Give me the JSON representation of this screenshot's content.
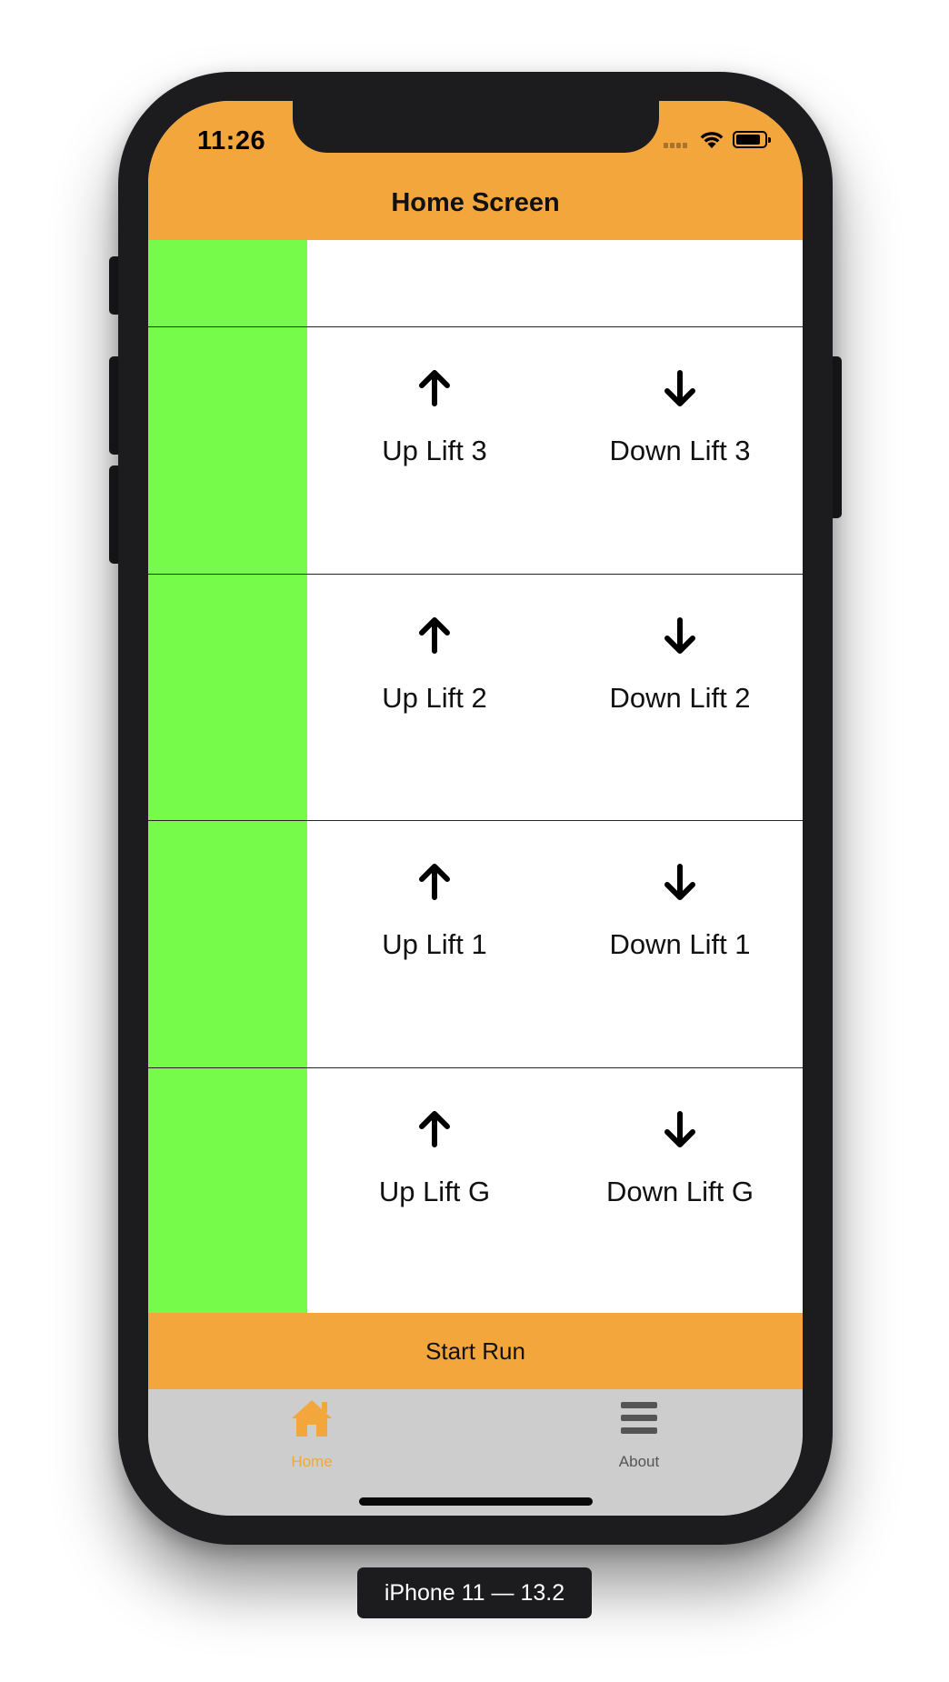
{
  "status_bar": {
    "time": "11:26"
  },
  "header": {
    "title": "Home Screen"
  },
  "colors": {
    "accent": "#f3a63c",
    "left_bar": "#77fb4b",
    "tabbar_bg": "#cdcdcd",
    "device": "#1c1c1e"
  },
  "floors": [
    {
      "up_label": "Up Lift 3",
      "down_label": "Down Lift 3",
      "up_icon": "arrow-up-icon",
      "down_icon": "arrow-down-icon"
    },
    {
      "up_label": "Up Lift 2",
      "down_label": "Down Lift 2",
      "up_icon": "arrow-up-icon",
      "down_icon": "arrow-down-icon"
    },
    {
      "up_label": "Up Lift 1",
      "down_label": "Down Lift 1",
      "up_icon": "arrow-up-icon",
      "down_icon": "arrow-down-icon"
    },
    {
      "up_label": "Up Lift G",
      "down_label": "Down Lift G",
      "up_icon": "arrow-up-icon",
      "down_icon": "arrow-down-icon"
    }
  ],
  "action": {
    "start_run_label": "Start Run"
  },
  "tabbar": {
    "tabs": [
      {
        "label": "Home",
        "icon": "home-icon",
        "active": true
      },
      {
        "label": "About",
        "icon": "menu-icon",
        "active": false
      }
    ]
  },
  "device_label": "iPhone 11 — 13.2"
}
